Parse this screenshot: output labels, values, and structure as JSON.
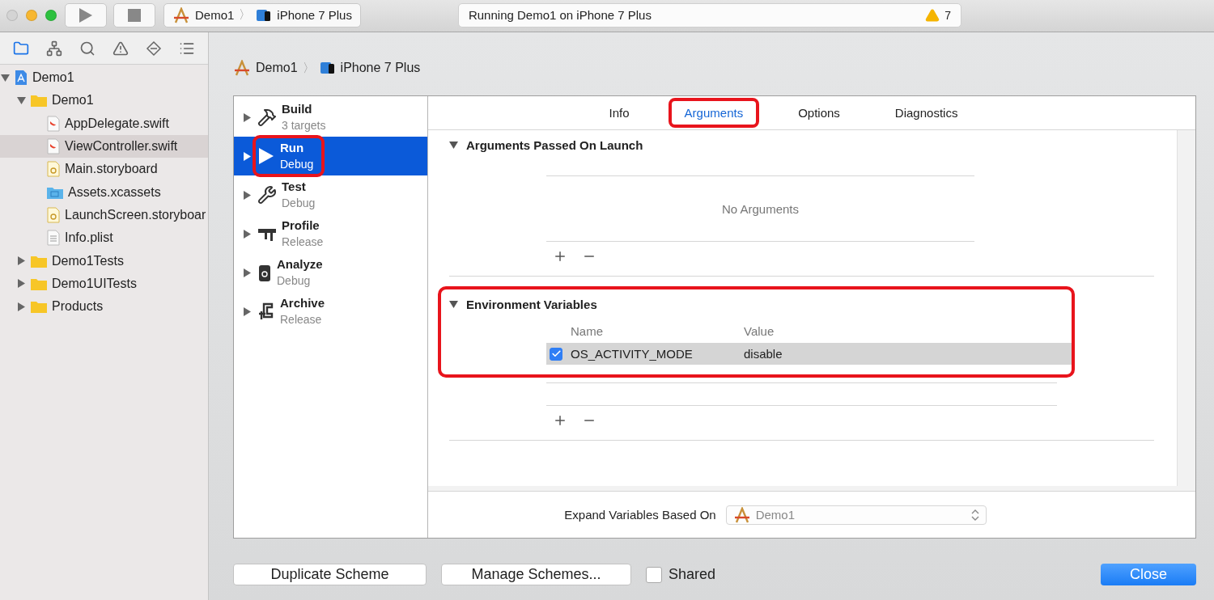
{
  "toolbar": {
    "scheme": {
      "project": "Demo1",
      "separator": "〉",
      "device": "iPhone 7 Plus"
    },
    "status": "Running Demo1 on iPhone 7 Plus",
    "warning_count": "7"
  },
  "navigator": {
    "tabs": [
      {
        "kind": "folder",
        "selected": true
      },
      {
        "kind": "hierarchy",
        "selected": false
      },
      {
        "kind": "search",
        "selected": false
      },
      {
        "kind": "warning",
        "selected": false
      },
      {
        "kind": "breakpoint",
        "selected": false
      },
      {
        "kind": "list",
        "selected": false
      }
    ],
    "tree": [
      {
        "label": "Demo1",
        "kind": "project",
        "expanded": true,
        "selected": false,
        "children": [
          {
            "label": "Demo1",
            "kind": "folder",
            "expanded": true,
            "selected": false,
            "children": [
              {
                "label": "AppDelegate.swift",
                "kind": "swift",
                "selected": false
              },
              {
                "label": "ViewController.swift",
                "kind": "swift",
                "selected": true
              },
              {
                "label": "Main.storyboard",
                "kind": "storyboard",
                "selected": false
              },
              {
                "label": "Assets.xcassets",
                "kind": "assets",
                "selected": false
              },
              {
                "label": "LaunchScreen.storyboar",
                "kind": "storyboard",
                "selected": false
              },
              {
                "label": "Info.plist",
                "kind": "plist",
                "selected": false
              }
            ]
          },
          {
            "label": "Demo1Tests",
            "kind": "folder",
            "expanded": false,
            "selected": false
          },
          {
            "label": "Demo1UITests",
            "kind": "folder",
            "expanded": false,
            "selected": false
          },
          {
            "label": "Products",
            "kind": "folder",
            "expanded": false,
            "selected": false
          }
        ]
      }
    ]
  },
  "sheet": {
    "breadcrumb": {
      "project": "Demo1",
      "separator": "〉",
      "device": "iPhone 7 Plus"
    },
    "actions": [
      {
        "name": "Build",
        "detail": "3 targets",
        "kind": "build",
        "selected": false,
        "highlighted": false
      },
      {
        "name": "Run",
        "detail": "Debug",
        "kind": "run",
        "selected": true,
        "highlighted": true
      },
      {
        "name": "Test",
        "detail": "Debug",
        "kind": "test",
        "selected": false,
        "highlighted": false
      },
      {
        "name": "Profile",
        "detail": "Release",
        "kind": "profile",
        "selected": false,
        "highlighted": false
      },
      {
        "name": "Analyze",
        "detail": "Debug",
        "kind": "analyze",
        "selected": false,
        "highlighted": false
      },
      {
        "name": "Archive",
        "detail": "Release",
        "kind": "archive",
        "selected": false,
        "highlighted": false
      }
    ],
    "tabs": [
      {
        "label": "Info",
        "selected": false,
        "highlighted": false
      },
      {
        "label": "Arguments",
        "selected": true,
        "highlighted": true
      },
      {
        "label": "Options",
        "selected": false,
        "highlighted": false
      },
      {
        "label": "Diagnostics",
        "selected": false,
        "highlighted": false
      }
    ],
    "arguments": {
      "title": "Arguments Passed On Launch",
      "expanded": true,
      "empty_text": "No Arguments"
    },
    "environment": {
      "title": "Environment Variables",
      "expanded": true,
      "highlighted": true,
      "columns": [
        "Name",
        "Value"
      ],
      "rows": [
        {
          "checked": true,
          "name": "OS_ACTIVITY_MODE",
          "value": "disable",
          "selected": true
        }
      ]
    },
    "expand_variables": {
      "label": "Expand Variables Based On",
      "value": "Demo1"
    },
    "footer": {
      "duplicate": "Duplicate Scheme",
      "manage": "Manage Schemes...",
      "shared": {
        "label": "Shared",
        "checked": false
      },
      "close": "Close"
    }
  }
}
